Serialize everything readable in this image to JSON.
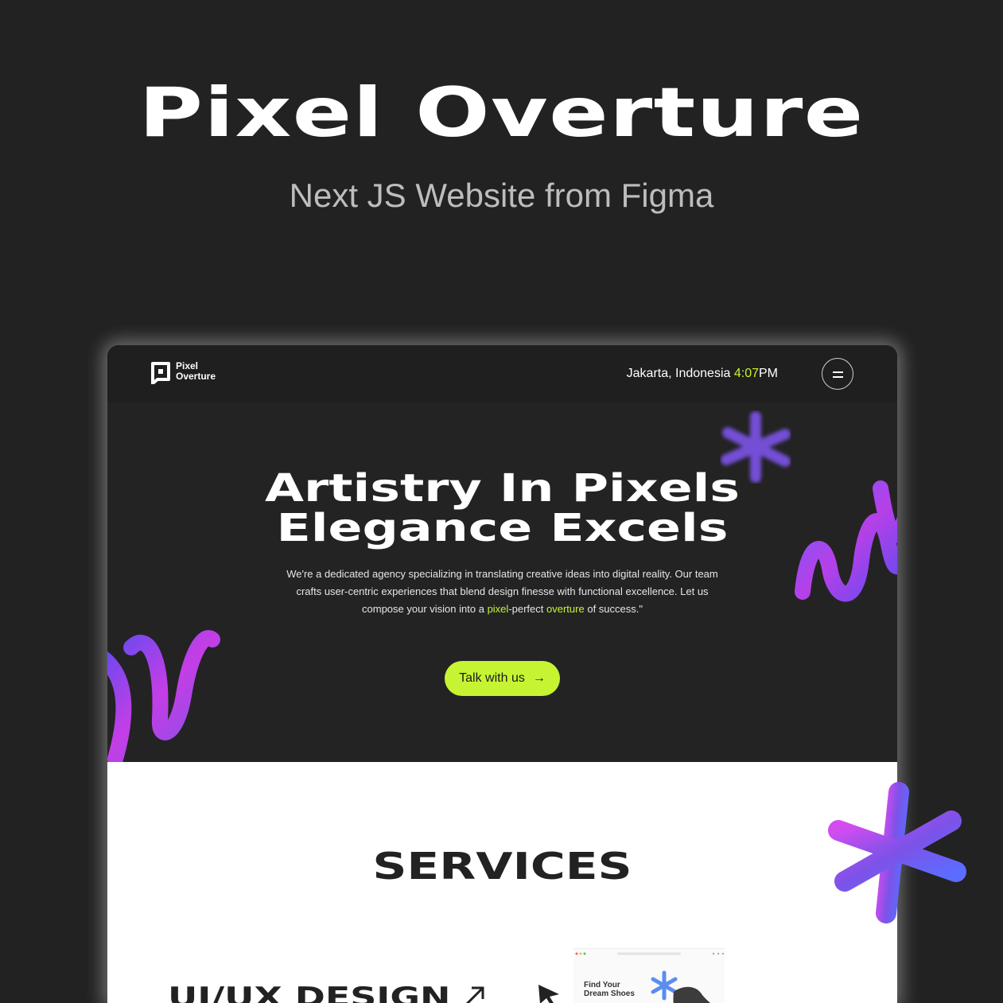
{
  "promo": {
    "title": "Pixel Overture",
    "subtitle": "Next JS Website from Figma"
  },
  "site": {
    "logo_line1": "Pixel",
    "logo_line2": "Overture",
    "location": "Jakarta, Indonesia",
    "time": "4:07",
    "meridiem": "PM",
    "hero": {
      "line1": "Artistry In Pixels",
      "line2": "Elegance Excels",
      "desc_1": "We're a dedicated agency specializing in translating creative ideas into digital reality. Our team crafts user-centric experiences that blend design finesse with functional excellence. Let us compose your vision into a",
      "desc_hl1": "pixel",
      "desc_2": "-perfect",
      "desc_hl2": "overture",
      "desc_3": "of success.\"",
      "cta": "Talk with us",
      "cta_arrow": "→"
    },
    "services": {
      "title": "SERVICES",
      "item1": "UI/UX DESIGN",
      "thumb_title_1": "Find Your",
      "thumb_title_2": "Dream Shoes"
    }
  },
  "colors": {
    "background": "#222222",
    "accent": "#c6f432",
    "purple": "#8a4bff",
    "magenta": "#c43ee6"
  }
}
